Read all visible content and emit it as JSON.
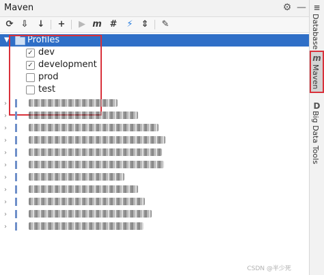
{
  "window": {
    "title": "Maven"
  },
  "toolbar": {
    "buttons": [
      {
        "name": "reload-icon",
        "glyph": "⟳"
      },
      {
        "name": "generate-sources-icon",
        "glyph": "⇩"
      },
      {
        "name": "download-icon",
        "glyph": "↓"
      },
      {
        "name": "add-icon",
        "glyph": "+"
      },
      {
        "name": "run-icon",
        "glyph": "▶"
      },
      {
        "name": "execute-goal-icon",
        "glyph": "m"
      },
      {
        "name": "toggle-offline-icon",
        "glyph": "#"
      },
      {
        "name": "skip-tests-icon",
        "glyph": "⚡"
      },
      {
        "name": "collapse-icon",
        "glyph": "⇕"
      },
      {
        "name": "settings-wrench-icon",
        "glyph": "✎"
      }
    ]
  },
  "tree": {
    "profiles_label": "Profiles",
    "profiles": [
      {
        "label": "dev",
        "checked": true
      },
      {
        "label": "development",
        "checked": true
      },
      {
        "label": "prod",
        "checked": false
      },
      {
        "label": "test",
        "checked": false
      }
    ],
    "modules_blurred_count": 11
  },
  "side_tabs": [
    {
      "label": "Database",
      "icon": "database-icon"
    },
    {
      "label": "Maven",
      "icon": "maven-icon",
      "active": true
    },
    {
      "label": "Big Data Tools",
      "icon": "big-data-tools-icon"
    }
  ],
  "watermark": "CSDN @半少死",
  "colors": {
    "selection": "#2f6fc7",
    "highlight_box": "#d9303a"
  }
}
